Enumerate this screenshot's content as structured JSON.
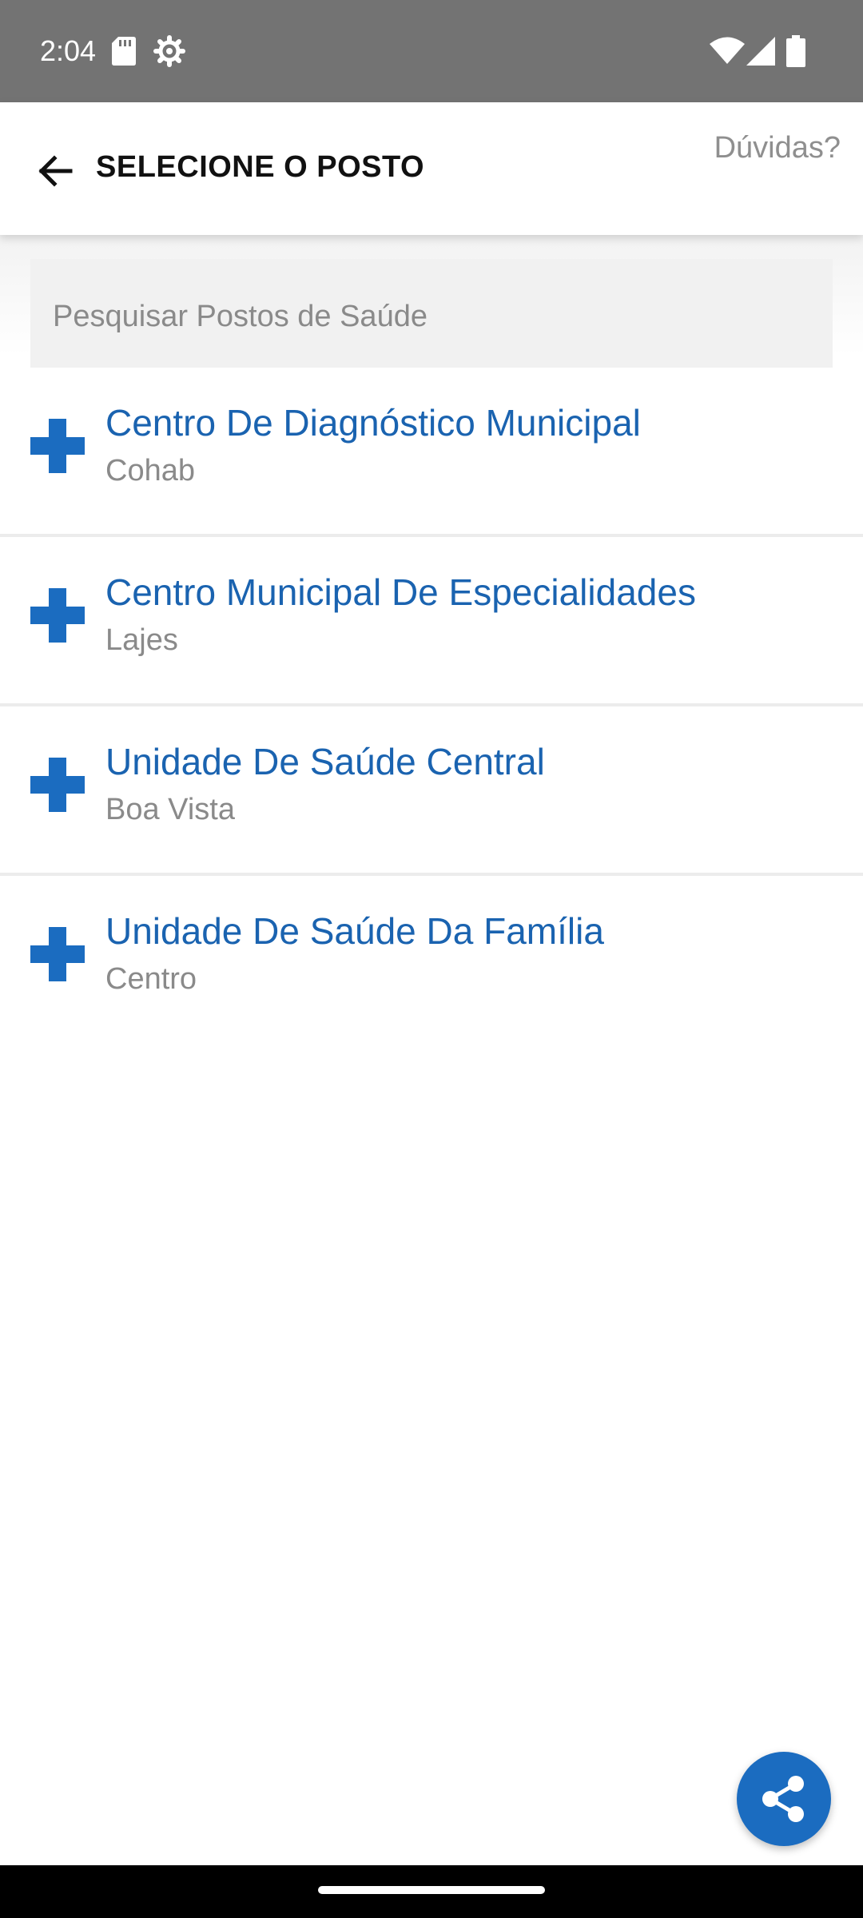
{
  "status_bar": {
    "time": "2:04",
    "icons": [
      "sd-card-icon",
      "gear-icon",
      "wifi-icon",
      "cell-signal-icon",
      "battery-icon"
    ]
  },
  "app_bar": {
    "title": "SELECIONE O POSTO",
    "help_label": "Dúvidas?"
  },
  "search": {
    "placeholder": "Pesquisar Postos de Saúde",
    "value": ""
  },
  "posts": [
    {
      "name": "Centro De Diagnóstico Municipal",
      "neighborhood": "Cohab"
    },
    {
      "name": "Centro Municipal De Especialidades",
      "neighborhood": "Lajes"
    },
    {
      "name": "Unidade De Saúde Central",
      "neighborhood": "Boa Vista"
    },
    {
      "name": "Unidade De Saúde Da Família",
      "neighborhood": "Centro"
    }
  ],
  "colors": {
    "accent": "#1a63b0",
    "fab": "#1b6cc0",
    "status_bar": "#737373",
    "subtitle": "#8a8a8a"
  },
  "fab": {
    "icon": "share-icon"
  }
}
